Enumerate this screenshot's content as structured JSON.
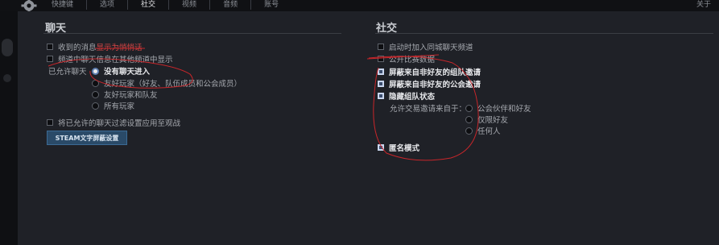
{
  "tabs": [
    "快捷键",
    "选项",
    "社交",
    "视频",
    "音频",
    "账号"
  ],
  "active_tab": "社交",
  "about": "关于",
  "chat": {
    "title": "聊天",
    "opt1_prefix": "收到的消息",
    "opt1_highlight": "显示为悄悄话",
    "opt2": "频道中聊天信息在其他频道中显示",
    "allowed_label": "已允许聊天",
    "radios": [
      "没有聊天进入",
      "友好玩家（好友、队伍成员和公会成员）",
      "友好玩家和队友",
      "所有玩家"
    ],
    "apply_filter": "将已允许的聊天过滤设置应用至观战",
    "steam_button": "STEAM文字屏蔽设置"
  },
  "social": {
    "title": "社交",
    "opt_auto_join": "启动时加入同城聊天频道",
    "opt_public": "公开比赛数据",
    "opt_block_party": "屏蔽来自非好友的组队邀请",
    "opt_block_guild": "屏蔽来自非好友的公会邀请",
    "opt_hide_party": "隐藏组队状态",
    "trade_label": "允许交易邀请来自于：",
    "trade_radios": [
      "公会伙伴和好友",
      "仅限好友",
      "任何人"
    ],
    "anon_mode": "匿名模式"
  },
  "colors": {
    "annotation_red": "#c8262a",
    "accent_blue": "#2a4a68"
  }
}
